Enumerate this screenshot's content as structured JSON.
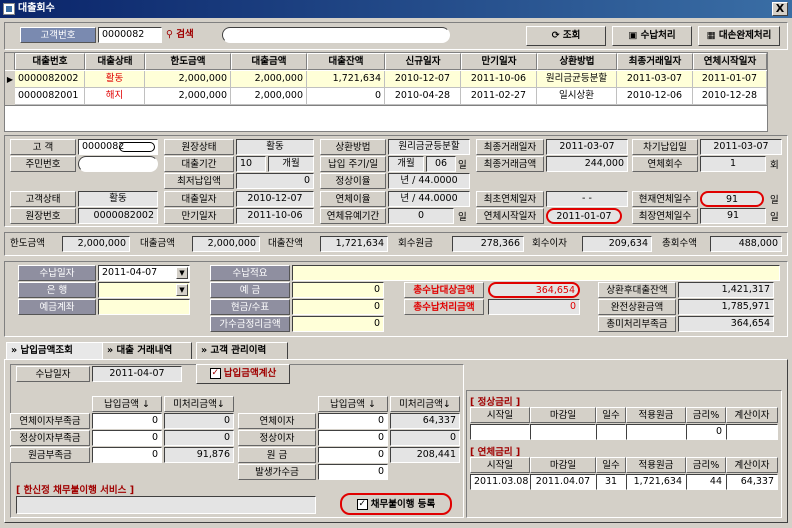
{
  "window": {
    "title": "대출회수",
    "close": "X"
  },
  "top": {
    "customer_no_label": "고객번호",
    "customer_no": "0000082",
    "search_label": "검색",
    "search_value": "",
    "btn_query": "조회",
    "btn_receive": "수납처리",
    "btn_full_repay": "대손완제처리"
  },
  "loan_grid": {
    "headers": [
      "대출번호",
      "대출상태",
      "한도금액",
      "대출금액",
      "대출잔액",
      "신규일자",
      "만기일자",
      "상환방법",
      "최종거래일자",
      "연체시작일자"
    ],
    "rows": [
      [
        "0000082002",
        "활동",
        "2,000,000",
        "2,000,000",
        "1,721,634",
        "2010-12-07",
        "2011-10-06",
        "원리금균등분할",
        "2011-03-07",
        "2011-01-07"
      ],
      [
        "0000082001",
        "해지",
        "2,000,000",
        "2,000,000",
        "0",
        "2010-04-28",
        "2011-02-27",
        "일시상환",
        "2010-12-06",
        "2010-12-28"
      ]
    ]
  },
  "info": {
    "customer_label": "고 객",
    "customer_val": "0000082",
    "resident_label": "주민번호",
    "resident_val": "",
    "cust_status_label": "고객상태",
    "cust_status_val": "활동",
    "ledger_no_label": "원장번호",
    "ledger_no_val": "0000082002",
    "ledger_status_label": "원장상태",
    "ledger_status_val": "활동",
    "loan_period_label": "대출기간",
    "loan_period_val": "10",
    "loan_period_unit": "개월",
    "min_pay_label": "최저납입액",
    "min_pay_val": "0",
    "loan_date_label": "대출일자",
    "loan_date_val": "2010-12-07",
    "maturity_label": "만기일자",
    "maturity_val": "2011-10-06",
    "repay_method_label": "상환방법",
    "repay_method_val": "원리금균등분할",
    "pay_cycle_label": "납입 주기/일",
    "pay_cycle_val": "개월",
    "pay_day": "06",
    "pay_day_unit": "일",
    "normal_rate_label": "정상이율",
    "normal_rate_val": "년 / 44.0000",
    "overdue_rate_label": "연체이율",
    "overdue_rate_val": "년 / 44.0000",
    "grace_label": "연체유예기간",
    "grace_val": "0",
    "grace_unit": "일",
    "last_tx_date_label": "최종거래일자",
    "last_tx_date_val": "2011-03-07",
    "last_tx_amt_label": "최종거래금액",
    "last_tx_amt_val": "244,000",
    "first_overdue_label": "최초연체일자",
    "first_overdue_val": "- -",
    "overdue_start_label": "연체시작일자",
    "overdue_start_val": "2011-01-07",
    "next_pay_label": "차기납입일",
    "next_pay_val": "2011-03-07",
    "overdue_cnt_label": "연체회수",
    "overdue_cnt_val": "1",
    "overdue_cnt_unit": "회",
    "cur_overdue_days_label": "현재연체일수",
    "cur_overdue_days_val": "91",
    "days_unit": "일",
    "max_overdue_days_label": "최장연체일수",
    "max_overdue_days_val": "91"
  },
  "summary": {
    "limit_label": "한도금액",
    "limit_val": "2,000,000",
    "loan_label": "대출금액",
    "loan_val": "2,000,000",
    "balance_label": "대출잔액",
    "balance_val": "1,721,634",
    "principal_label": "회수원금",
    "principal_val": "278,366",
    "interest_label": "회수이자",
    "interest_val": "209,634",
    "total_label": "총회수액",
    "total_val": "488,000"
  },
  "receive": {
    "date_label": "수납일자",
    "date_val": "2011-04-07",
    "bank_label": "은 행",
    "bank_val": "",
    "account_label": "예금계좌",
    "account_val": "",
    "memo_label": "수납적요",
    "memo_val": "",
    "deposit_label": "예 금",
    "deposit_val": "0",
    "cash_label": "현금/수표",
    "cash_val": "0",
    "suspense_label": "가수금정리금액",
    "suspense_val": "0",
    "total_target_label": "총수납대상금액",
    "total_target_val": "364,654",
    "total_processed_label": "총수납처리금액",
    "total_processed_val": "0",
    "after_balance_label": "상환후대출잔액",
    "after_balance_val": "1,421,317",
    "full_repay_label": "완전상환금액",
    "full_repay_val": "1,785,971",
    "unprocessed_label": "총미처리부족금",
    "unprocessed_val": "364,654"
  },
  "tabs": [
    "납입금액조회",
    "대출 거래내역",
    "고객 관리이력"
  ],
  "tabpanel": {
    "date_label": "수납일자",
    "date_val": "2011-04-07",
    "calc_label": "납입금액계산",
    "left_headers": [
      "납입금액 ↓",
      "미처리금액↓"
    ],
    "left_rows": [
      {
        "label": "연체이자부족금",
        "a": "0",
        "b": "0"
      },
      {
        "label": "정상이자부족금",
        "a": "0",
        "b": "0"
      },
      {
        "label": "원금부족금",
        "a": "0",
        "b": "91,876"
      }
    ],
    "mid_headers": [
      "납입금액 ↓",
      "미처리금액↓"
    ],
    "mid_rows": [
      {
        "label": "연체이자",
        "a": "0",
        "b": "64,337"
      },
      {
        "label": "정상이자",
        "a": "0",
        "b": "0"
      },
      {
        "label": "원 금",
        "a": "0",
        "b": "208,441"
      },
      {
        "label": "발생가수금",
        "a": "0",
        "b": ""
      }
    ],
    "service_label": "[ 한신정 채무불이행 서비스 ]",
    "register_label": "채무불이행 등록",
    "normal_rate_title": "[ 정상금리 ]",
    "overdue_rate_title": "[ 연체금리 ]",
    "rate_headers": [
      "시작일",
      "마감일",
      "일수",
      "적용원금",
      "금리%",
      "계산이자"
    ],
    "normal_rows": [
      [
        "",
        "",
        "",
        "",
        "0",
        ""
      ]
    ],
    "overdue_rows": [
      [
        "2011.03.08",
        "2011.04.07",
        "31",
        "1,721,634",
        "44",
        "64,337"
      ]
    ]
  }
}
